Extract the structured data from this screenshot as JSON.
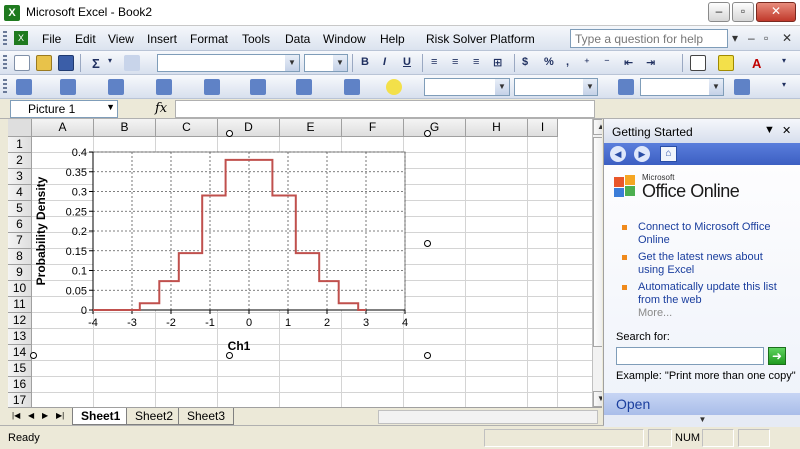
{
  "window": {
    "title": "Microsoft Excel - Book2",
    "app_icon": "excel-icon",
    "controls": [
      "minimize",
      "restore",
      "close"
    ]
  },
  "menubar": {
    "items": [
      "File",
      "Edit",
      "View",
      "Insert",
      "Format",
      "Tools",
      "Data",
      "Window",
      "Help",
      "Risk Solver Platform"
    ],
    "help_placeholder": "Type a question for help",
    "mdi_controls": [
      "▾",
      "–",
      "▫",
      "✕"
    ]
  },
  "toolbar": {
    "autosum": "Σ",
    "bold": "B",
    "italic": "I",
    "underline": "U",
    "currency": "$",
    "percent": "%"
  },
  "formula_bar": {
    "name_box": "Picture 1",
    "fx": "fx",
    "formula": ""
  },
  "grid": {
    "columns": [
      "A",
      "B",
      "C",
      "D",
      "E",
      "F",
      "G",
      "H",
      "I"
    ],
    "rows": [
      "1",
      "2",
      "3",
      "4",
      "5",
      "6",
      "7",
      "8",
      "9",
      "10",
      "11",
      "12",
      "13",
      "14",
      "15",
      "16",
      "17"
    ]
  },
  "chart_data": {
    "type": "line",
    "title": "",
    "xlabel": "Ch1",
    "ylabel": "Probability Density",
    "xlim": [
      -4,
      4
    ],
    "ylim": [
      0,
      0.4
    ],
    "xticks": [
      -4,
      -3,
      -2,
      -1,
      0,
      1,
      2,
      3,
      4
    ],
    "yticks": [
      0,
      0.05,
      0.1,
      0.15,
      0.2,
      0.25,
      0.3,
      0.35,
      0.4
    ],
    "ytick_labels": [
      "0",
      "0.05",
      "0.1",
      "0.15",
      "0.2",
      "0.25",
      "0.3",
      "0.35",
      "0.4"
    ],
    "grid": true,
    "line_color": "#c0504d",
    "series": [
      {
        "values_x": [
          -4,
          -2.8,
          -2.8,
          -2.3,
          -2.3,
          -1.8,
          -1.8,
          -1.2,
          -1.2,
          -0.6,
          -0.6,
          0.6,
          0.6,
          1.2,
          1.2,
          1.8,
          1.8,
          2.3,
          2.3,
          2.8,
          2.8,
          3.0
        ],
        "values_y": [
          0,
          0,
          0.017,
          0.017,
          0.073,
          0.073,
          0.144,
          0.144,
          0.29,
          0.29,
          0.38,
          0.38,
          0.29,
          0.29,
          0.144,
          0.144,
          0.073,
          0.073,
          0.017,
          0.017,
          0,
          0
        ]
      }
    ]
  },
  "sheets": {
    "tabs": [
      "Sheet1",
      "Sheet2",
      "Sheet3"
    ],
    "active": "Sheet1"
  },
  "statusbar": {
    "ready": "Ready",
    "num": "NUM"
  },
  "taskpane": {
    "title": "Getting Started",
    "logo_small": "Microsoft",
    "logo_big": "Office Online",
    "links": [
      "Connect to Microsoft Office Online",
      "Get the latest news about using Excel",
      "Automatically update this list from the web"
    ],
    "more": "More...",
    "search_label": "Search for:",
    "search_value": "",
    "example": "Example:  \"Print more than one copy\"",
    "open_label": "Open",
    "accent": "#3c5fc2"
  }
}
